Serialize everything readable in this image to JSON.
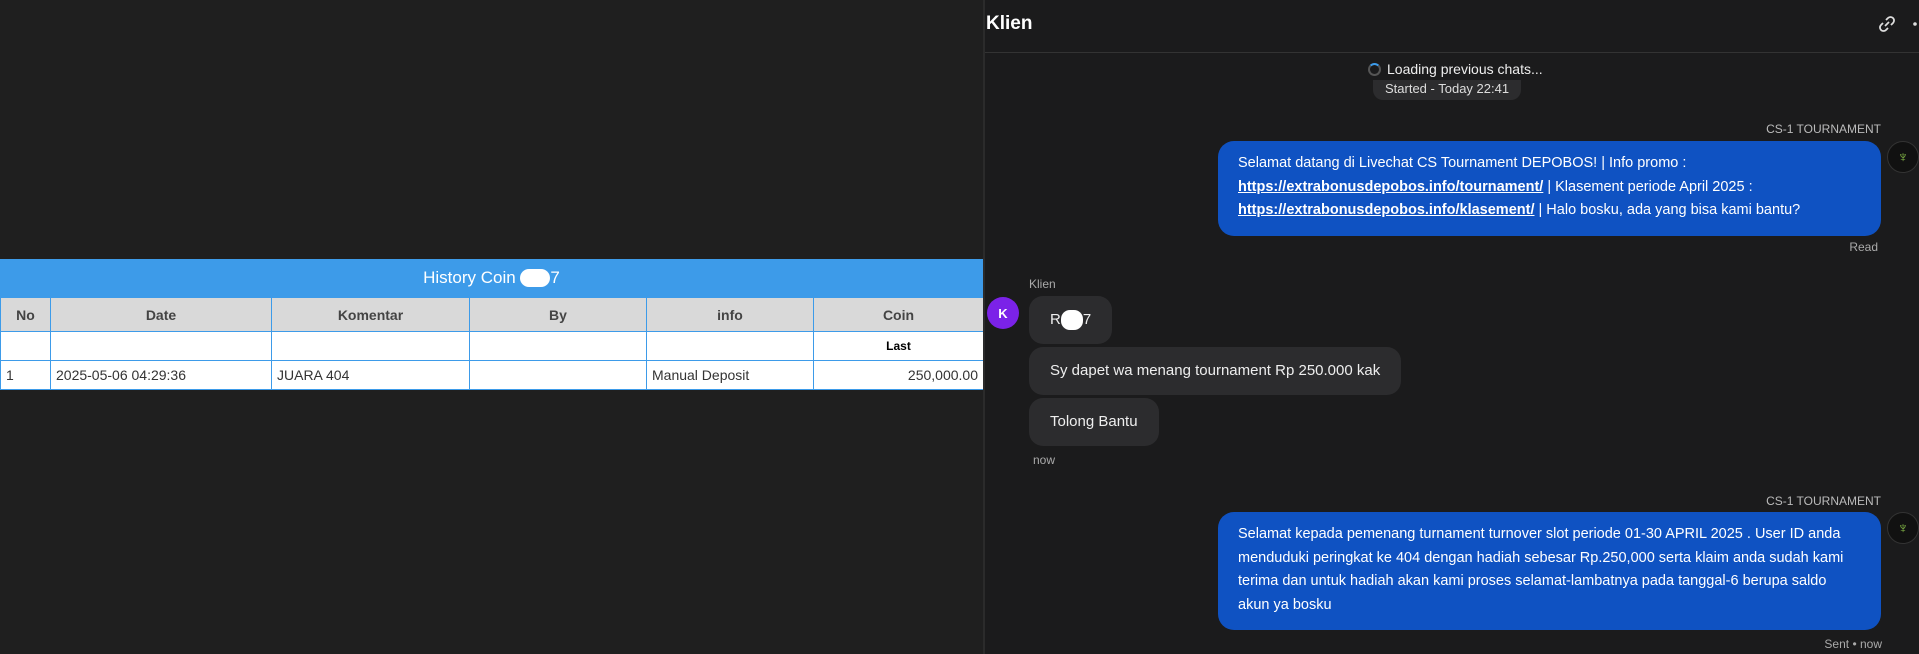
{
  "history": {
    "title_prefix": "History Coin",
    "title_suffix": "7",
    "columns": [
      "No",
      "Date",
      "Komentar",
      "By",
      "info",
      "Coin"
    ],
    "sub_label": "Last",
    "rows": [
      {
        "no": "1",
        "date": "2025-05-06 04:29:36",
        "komentar": "JUARA 404",
        "by": "",
        "info": "Manual Deposit",
        "coin": "250,000.00"
      }
    ]
  },
  "chat": {
    "title": "Klien",
    "link_icon": "link-icon",
    "more_icon": "more-icon",
    "loading_text": "Loading previous chats...",
    "started_text": "Started - Today 22:41",
    "agent_name": "CS-1 TOURNAMENT",
    "msg1": {
      "text1": "Selamat datang di Livechat CS Tournament DEPOBOS! | Info promo :",
      "link1": "https://extrabonusdepobos.info/tournament/",
      "text2": " | Klasement periode April 2025 :",
      "link2": "https://extrabonusdepobos.info/klasement/",
      "text3": " | Halo bosku, ada yang bisa kami bantu?",
      "status": "Read"
    },
    "client_label": "Klien",
    "client_avatar": "K",
    "client_msgs": [
      {
        "text_prefix": "R",
        "text_suffix": "7"
      },
      {
        "text": "Sy dapet wa menang tournament Rp 250.000 kak"
      },
      {
        "text": "Tolong Bantu"
      }
    ],
    "client_time": "now",
    "msg2": {
      "text": "Selamat kepada pemenang turnament turnover slot periode 01-30 APRIL 2025 . User ID anda menduduki peringkat ke 404 dengan hadiah sebesar Rp.250,000 serta klaim anda sudah kami terima dan untuk hadiah akan kami proses selamat-lambatnya pada tanggal-6 berupa saldo akun ya bosku",
      "status": "Sent • now"
    },
    "colors": {
      "agent_bubble": "#0f52c2",
      "client_avatar": "#7b22e8",
      "table_header": "#3d9be9"
    }
  }
}
